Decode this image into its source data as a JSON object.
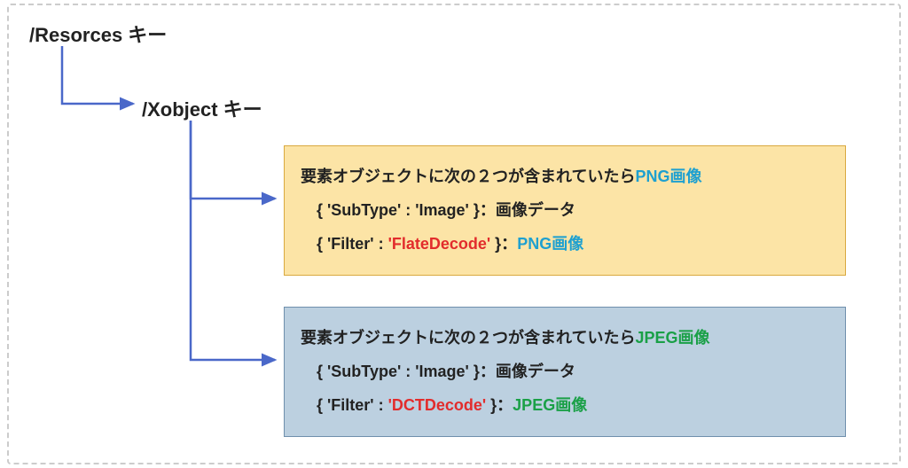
{
  "labels": {
    "resources": "/Resorces キー",
    "xobject": "/Xobject キー"
  },
  "box_png": {
    "line1_prefix": "要素オブジェクトに次の２つが含まれていたら",
    "line1_suffix": "PNG画像",
    "line2": "{ 'SubType' : 'Image' }：画像データ",
    "line3_prefix": "{ 'Filter' :  ",
    "line3_mid": "'FlateDecode'",
    "line3_post": " }：",
    "line3_suffix": "PNG画像"
  },
  "box_jpeg": {
    "line1_prefix": "要素オブジェクトに次の２つが含まれていたら",
    "line1_suffix": "JPEG画像",
    "line2": "{ 'SubType' : 'Image' }：画像データ",
    "line3_prefix": "{ 'Filter' :  ",
    "line3_mid": "'DCTDecode'",
    "line3_post": " }：",
    "line3_suffix": "JPEG画像"
  }
}
